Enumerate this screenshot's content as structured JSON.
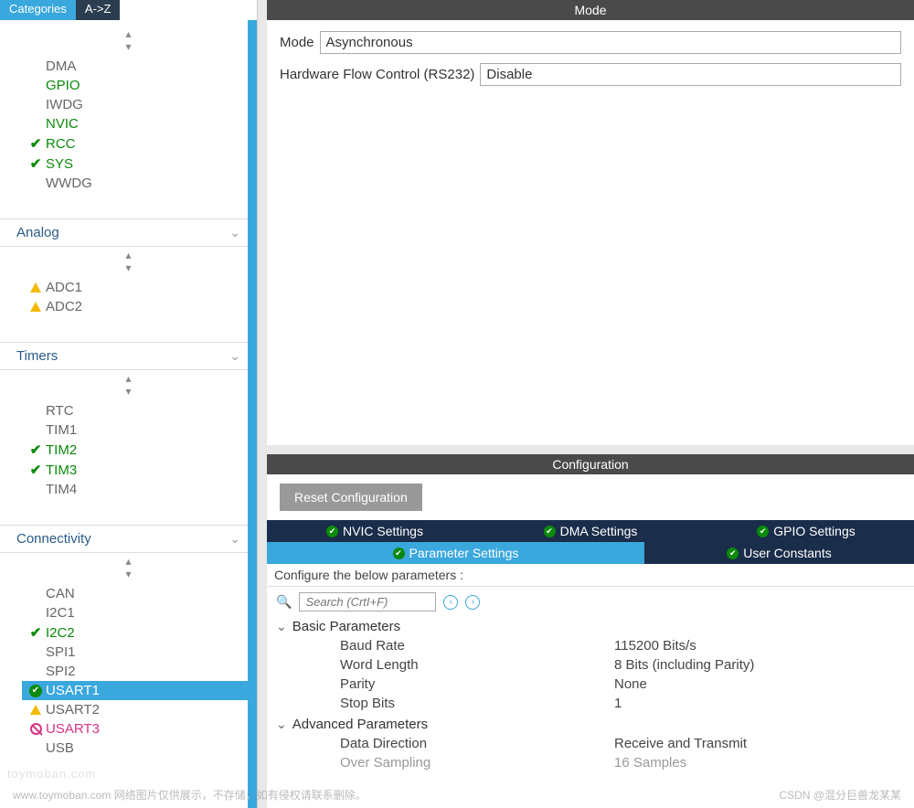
{
  "sidebar": {
    "tabs": {
      "categories": "Categories",
      "az": "A->Z"
    },
    "sections": {
      "system": {
        "items": [
          {
            "label": "DMA",
            "style": "muted",
            "icon": ""
          },
          {
            "label": "GPIO",
            "style": "green",
            "icon": ""
          },
          {
            "label": "IWDG",
            "style": "muted",
            "icon": ""
          },
          {
            "label": "NVIC",
            "style": "green",
            "icon": ""
          },
          {
            "label": "RCC",
            "style": "green",
            "icon": "check"
          },
          {
            "label": "SYS",
            "style": "green",
            "icon": "check"
          },
          {
            "label": "WWDG",
            "style": "muted",
            "icon": ""
          }
        ]
      },
      "analog": {
        "title": "Analog",
        "items": [
          {
            "label": "ADC1",
            "style": "muted",
            "icon": "warn"
          },
          {
            "label": "ADC2",
            "style": "muted",
            "icon": "warn"
          }
        ]
      },
      "timers": {
        "title": "Timers",
        "items": [
          {
            "label": "RTC",
            "style": "muted",
            "icon": ""
          },
          {
            "label": "TIM1",
            "style": "muted",
            "icon": ""
          },
          {
            "label": "TIM2",
            "style": "green",
            "icon": "check"
          },
          {
            "label": "TIM3",
            "style": "green",
            "icon": "check"
          },
          {
            "label": "TIM4",
            "style": "muted",
            "icon": ""
          }
        ]
      },
      "connectivity": {
        "title": "Connectivity",
        "items": [
          {
            "label": "CAN",
            "style": "muted",
            "icon": ""
          },
          {
            "label": "I2C1",
            "style": "muted",
            "icon": ""
          },
          {
            "label": "I2C2",
            "style": "green",
            "icon": "check"
          },
          {
            "label": "SPI1",
            "style": "muted",
            "icon": ""
          },
          {
            "label": "SPI2",
            "style": "muted",
            "icon": ""
          },
          {
            "label": "USART1",
            "style": "selected",
            "icon": "circle-check"
          },
          {
            "label": "USART2",
            "style": "muted",
            "icon": "warn"
          },
          {
            "label": "USART3",
            "style": "pink",
            "icon": "no"
          },
          {
            "label": "USB",
            "style": "muted",
            "icon": ""
          }
        ]
      }
    }
  },
  "mode": {
    "header": "Mode",
    "rows": {
      "mode_label": "Mode",
      "mode_value": "Asynchronous",
      "flow_label": "Hardware Flow Control (RS232)",
      "flow_value": "Disable"
    }
  },
  "config": {
    "header": "Configuration",
    "reset": "Reset Configuration",
    "top_tabs": {
      "nvic": "NVIC Settings",
      "dma": "DMA Settings",
      "gpio": "GPIO Settings"
    },
    "bottom_tabs": {
      "param": "Parameter Settings",
      "user": "User Constants"
    },
    "instruct": "Configure the below parameters :",
    "search_placeholder": "Search (CrtI+F)",
    "groups": {
      "basic": {
        "title": "Basic Parameters",
        "rows": [
          {
            "name": "Baud Rate",
            "value": "115200 Bits/s"
          },
          {
            "name": "Word Length",
            "value": "8 Bits (including Parity)"
          },
          {
            "name": "Parity",
            "value": "None"
          },
          {
            "name": "Stop Bits",
            "value": "1"
          }
        ]
      },
      "advanced": {
        "title": "Advanced Parameters",
        "rows": [
          {
            "name": "Data Direction",
            "value": "Receive and Transmit"
          },
          {
            "name": "Over Sampling",
            "value": "16 Samples",
            "dim": true
          }
        ]
      }
    }
  },
  "footer": {
    "left": "www.toymoban.com 网络图片仅供展示，不存储，如有侵权请联系删除。",
    "right": "CSDN @混分巨兽龙某某"
  },
  "watermark": "toymoban.com"
}
